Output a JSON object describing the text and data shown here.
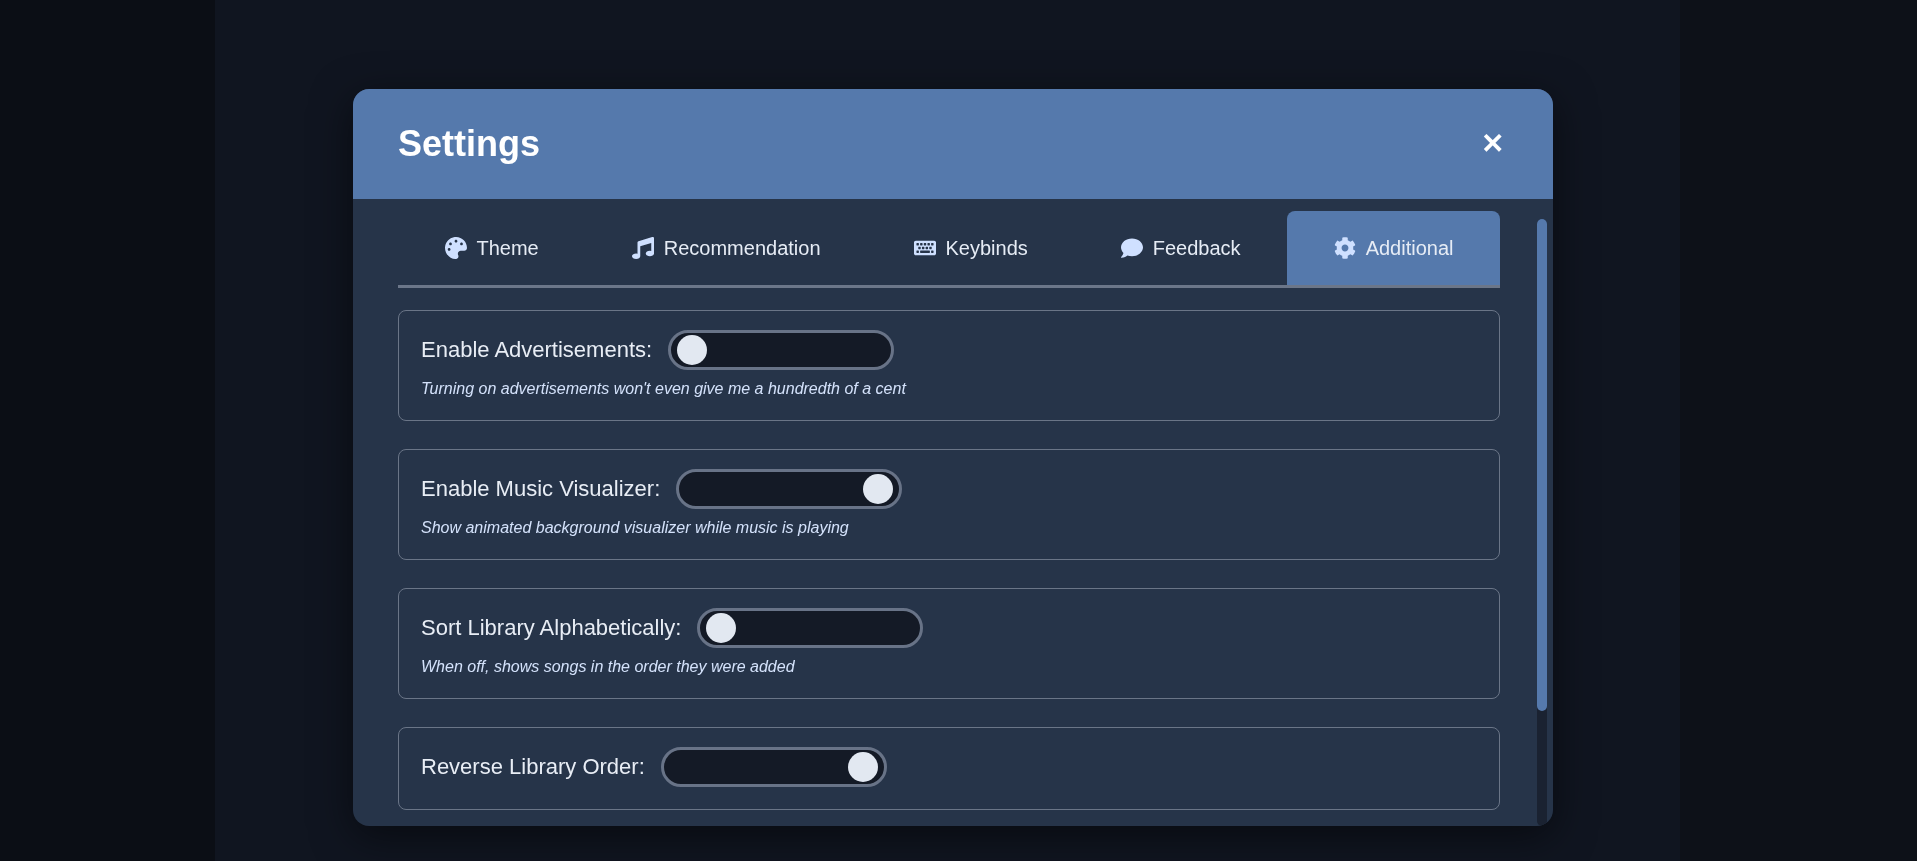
{
  "dialog": {
    "title": "Settings",
    "close": "✕"
  },
  "tabs": [
    {
      "label": "Theme",
      "selected": false
    },
    {
      "label": "Recommendation",
      "selected": false
    },
    {
      "label": "Keybinds",
      "selected": false
    },
    {
      "label": "Feedback",
      "selected": false
    },
    {
      "label": "Additional",
      "selected": true
    }
  ],
  "settings": [
    {
      "label": "Enable Advertisements:",
      "on": false,
      "description": "Turning on advertisements won't even give me a hundredth of a cent"
    },
    {
      "label": "Enable Music Visualizer:",
      "on": true,
      "description": "Show animated background visualizer while music is playing"
    },
    {
      "label": "Sort Library Alphabetically:",
      "on": false,
      "description": "When off, shows songs in the order they were added"
    },
    {
      "label": "Reverse Library Order:",
      "on": true
    }
  ]
}
